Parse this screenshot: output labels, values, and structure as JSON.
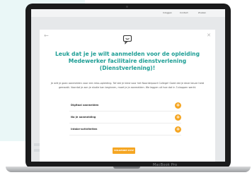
{
  "device": {
    "brand_label": "MacBook Pro"
  },
  "website": {
    "nav_items": [
      "Inloggen",
      "Contact",
      "Zoeken"
    ]
  },
  "modal": {
    "back_icon": "arrow-left-icon",
    "close_icon": "close-icon",
    "header_icon": "chat-bubble-icon",
    "title": "Leuk dat je je wilt aanmelden voor de opleiding Medewerker facilitaire dienstverlening (Dienstverlening)!",
    "intro": "Je wilt je gaan aanmelden voor een mbo-opleiding. Tof dat je kiest voor het Noorderpoort College! Goed dat je deze keuze hebt gemaakt. Voordat je aan je studie kan beginnen, moet je je aanmelden. We leggen uit hoe dat in 3 stappen werkt.",
    "steps": [
      {
        "label": "Digitaal aanmelden"
      },
      {
        "label": "Na je aanmelding"
      },
      {
        "label": "Intake-activiteiten"
      }
    ],
    "cta_label": "VOLGENDE STAP",
    "accent_color": "#1e9e95",
    "button_color": "#f5a623"
  }
}
